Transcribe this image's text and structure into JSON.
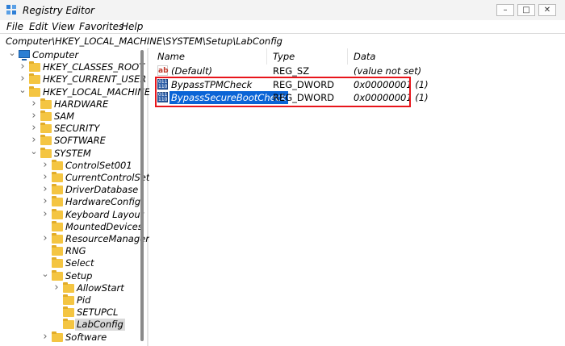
{
  "window": {
    "title": "Registry Editor",
    "minimize_label": "–",
    "maximize_label": "□",
    "close_label": "✕"
  },
  "menu": [
    "File",
    "Edit",
    "View",
    "Favorites",
    "Help"
  ],
  "address": "Computer\\HKEY_LOCAL_MACHINE\\SYSTEM\\Setup\\LabConfig",
  "tree": [
    {
      "label": "Computer",
      "level": 0,
      "expanded": true,
      "icon": "computer-icon"
    },
    {
      "label": "HKEY_CLASSES_ROOT",
      "level": 1,
      "expanded": false,
      "icon": "folder-icon"
    },
    {
      "label": "HKEY_CURRENT_USER",
      "level": 1,
      "expanded": false,
      "icon": "folder-icon"
    },
    {
      "label": "HKEY_LOCAL_MACHINE",
      "level": 1,
      "expanded": true,
      "icon": "folder-icon"
    },
    {
      "label": "HARDWARE",
      "level": 2,
      "expanded": false,
      "icon": "folder-icon"
    },
    {
      "label": "SAM",
      "level": 2,
      "expanded": false,
      "icon": "folder-icon"
    },
    {
      "label": "SECURITY",
      "level": 2,
      "expanded": false,
      "icon": "folder-icon"
    },
    {
      "label": "SOFTWARE",
      "level": 2,
      "expanded": false,
      "icon": "folder-icon"
    },
    {
      "label": "SYSTEM",
      "level": 2,
      "expanded": true,
      "icon": "folder-icon"
    },
    {
      "label": "ControlSet001",
      "level": 3,
      "expanded": false,
      "icon": "folder-icon"
    },
    {
      "label": "CurrentControlSet",
      "level": 3,
      "expanded": false,
      "icon": "folder-icon"
    },
    {
      "label": "DriverDatabase",
      "level": 3,
      "expanded": false,
      "icon": "folder-icon"
    },
    {
      "label": "HardwareConfig",
      "level": 3,
      "expanded": false,
      "icon": "folder-icon"
    },
    {
      "label": "Keyboard Layout",
      "level": 3,
      "expanded": false,
      "icon": "folder-icon"
    },
    {
      "label": "MountedDevices",
      "level": 3,
      "expanded": null,
      "icon": "folder-icon"
    },
    {
      "label": "ResourceManager",
      "level": 3,
      "expanded": false,
      "icon": "folder-icon"
    },
    {
      "label": "RNG",
      "level": 3,
      "expanded": null,
      "icon": "folder-icon"
    },
    {
      "label": "Select",
      "level": 3,
      "expanded": null,
      "icon": "folder-icon"
    },
    {
      "label": "Setup",
      "level": 3,
      "expanded": true,
      "icon": "folder-icon"
    },
    {
      "label": "AllowStart",
      "level": 4,
      "expanded": false,
      "icon": "folder-icon"
    },
    {
      "label": "Pid",
      "level": 4,
      "expanded": null,
      "icon": "folder-icon"
    },
    {
      "label": "SETUPCL",
      "level": 4,
      "expanded": null,
      "icon": "folder-icon"
    },
    {
      "label": "LabConfig",
      "level": 4,
      "expanded": null,
      "icon": "folder-icon",
      "selected": true
    },
    {
      "label": "Software",
      "level": 3,
      "expanded": false,
      "icon": "folder-icon"
    }
  ],
  "columns": {
    "name": "Name",
    "type": "Type",
    "data": "Data"
  },
  "values": [
    {
      "name": "(Default)",
      "type": "REG_SZ",
      "data": "(value not set)",
      "icon": "string-value-icon",
      "icon_text": "ab"
    },
    {
      "name": "BypassTPMCheck",
      "type": "REG_DWORD",
      "data": "0x00000001 (1)",
      "icon": "binary-value-icon",
      "icon_text": "011 110"
    },
    {
      "name": "BypassSecureBootCheck",
      "type": "REG_DWORD",
      "data": "0x00000001 (1)",
      "icon": "binary-value-icon",
      "icon_text": "011 110",
      "selected": true
    }
  ],
  "colors": {
    "selection": "#0a64d6",
    "highlight_box": "#e8151b",
    "folder": "#f4c542"
  }
}
